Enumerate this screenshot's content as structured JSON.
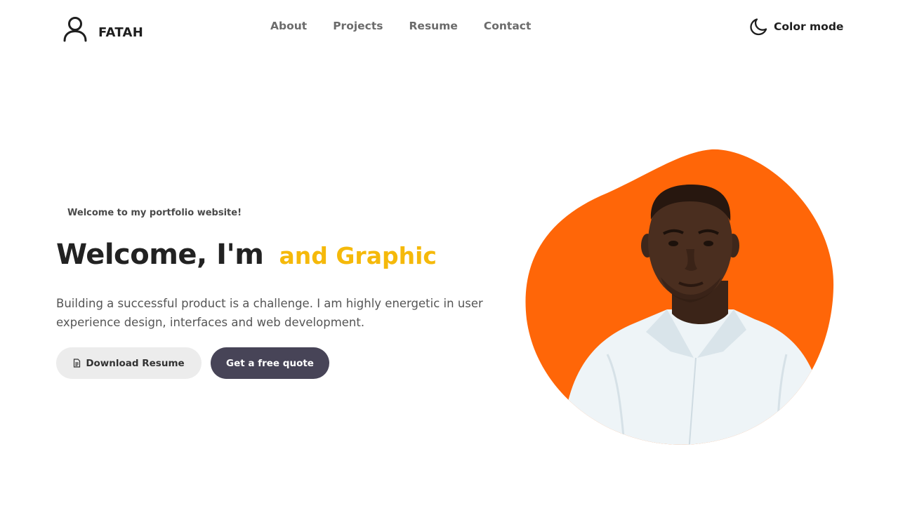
{
  "header": {
    "brand": "FATAH",
    "nav": {
      "about": "About",
      "projects": "Projects",
      "resume": "Resume",
      "contact": "Contact"
    },
    "color_mode_label": "Color mode"
  },
  "hero": {
    "greeting": "Welcome to my portfolio website!",
    "headline": "Welcome, I'm",
    "headline_accent": "and Graphic",
    "description": "Building a successful product is a challenge. I am highly energetic in user experience design, interfaces and web development.",
    "download_button": "Download Resume",
    "quote_button": "Get a free quote"
  },
  "colors": {
    "accent_yellow": "#f5b90a",
    "blob_orange": "#ff6608",
    "button_dark": "#474457",
    "button_light": "#ececec"
  },
  "icons": {
    "logo": "user-icon",
    "color_mode": "moon-icon",
    "download": "document-icon"
  }
}
